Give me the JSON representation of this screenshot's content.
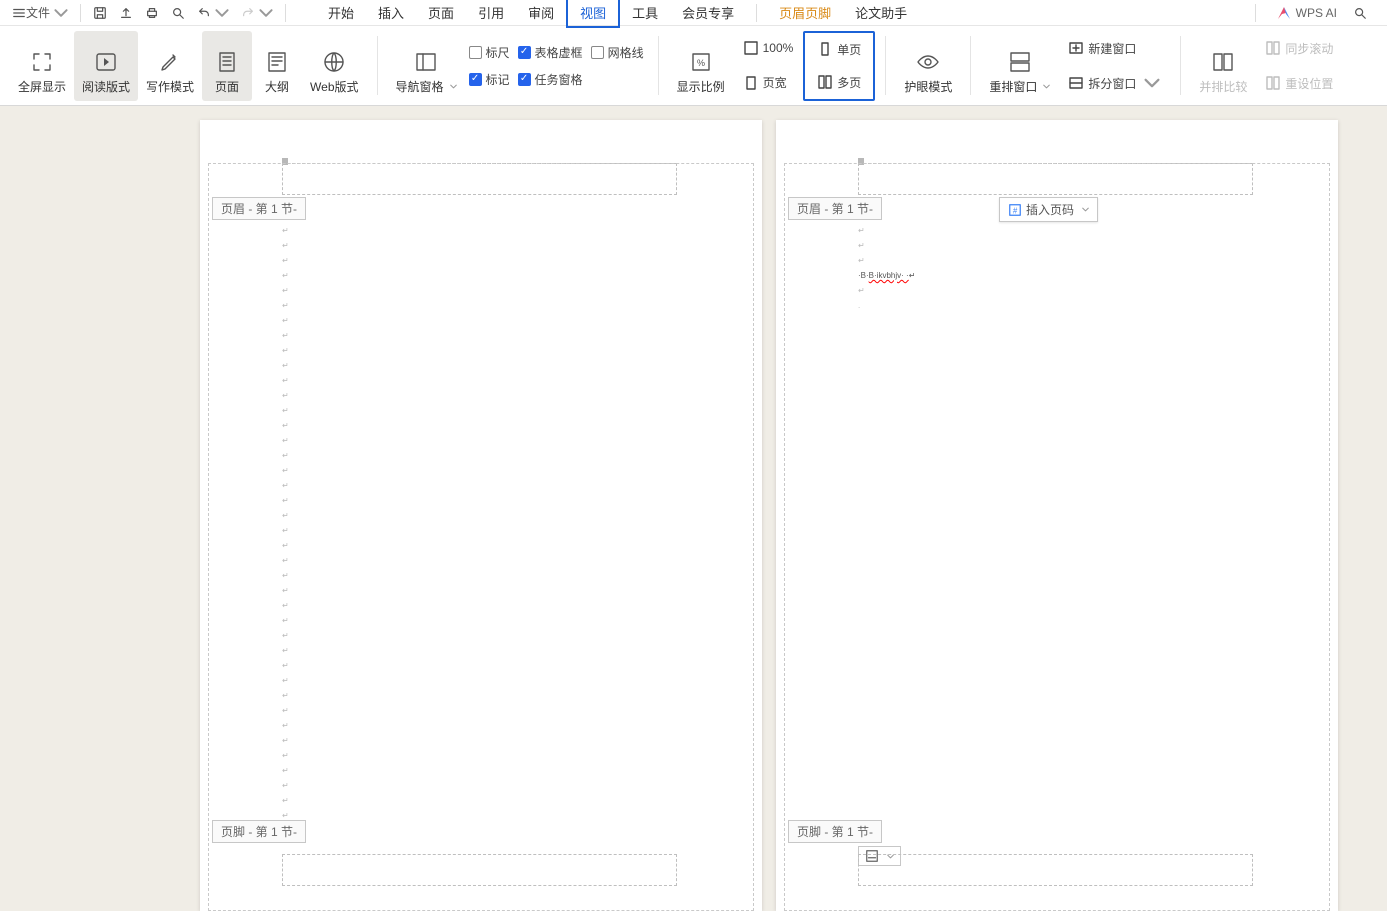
{
  "qat": {
    "file_label": "文件"
  },
  "tabs": {
    "t1": "开始",
    "t2": "插入",
    "t3": "页面",
    "t4": "引用",
    "t5": "审阅",
    "t6": "视图",
    "t7": "工具",
    "t8": "会员专享",
    "t9": "页眉页脚",
    "t10": "论文助手"
  },
  "ai_label": "WPS AI",
  "ribbon": {
    "fullscreen": "全屏显示",
    "read_mode": "阅读版式",
    "write_mode": "写作模式",
    "page": "页面",
    "outline": "大纲",
    "web": "Web版式",
    "nav_pane": "导航窗格",
    "ruler": "标尺",
    "marks": "标记",
    "table_lines": "表格虚框",
    "task_pane": "任务窗格",
    "grid": "网格线",
    "zoom": "显示比例",
    "hundred": "100%",
    "page_width": "页宽",
    "single_page": "单页",
    "multi_page": "多页",
    "eye_mode": "护眼模式",
    "rearrange": "重排窗口",
    "new_window": "新建窗口",
    "split_window": "拆分窗口",
    "compare": "并排比较",
    "sync_scroll": "同步滚动",
    "reset_pos": "重设位置"
  },
  "document": {
    "header_tag": "页眉 - 第 1 节-",
    "footer_tag": "页脚 - 第 1 节-",
    "insert_pagenum": "插入页码",
    "content_line": "B·ikvbhjv· ·",
    "para_mark": "↵"
  }
}
